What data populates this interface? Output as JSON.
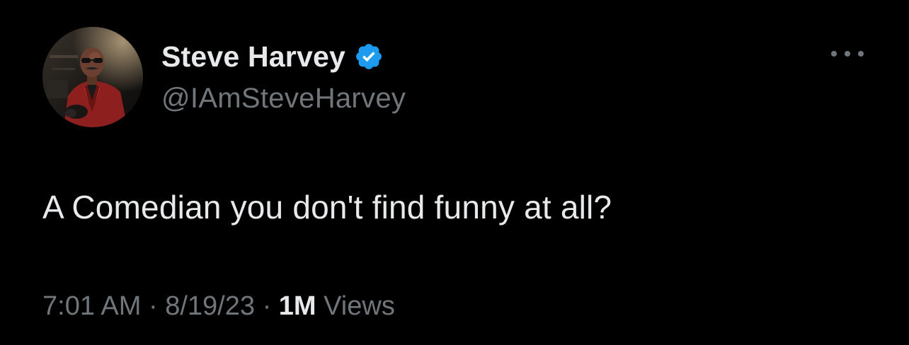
{
  "author": {
    "display_name": "Steve Harvey",
    "handle": "@IAmSteveHarvey",
    "verified": true,
    "verified_icon": "verified-badge-icon",
    "verified_color": "#1d9bf0"
  },
  "tweet": {
    "text": "A Comedian you don't find funny at all?",
    "time": "7:01 AM",
    "date": "8/19/23",
    "views_count": "1M",
    "views_label": "Views",
    "separator": "·"
  },
  "menu": {
    "icon": "more-options-icon"
  },
  "colors": {
    "background": "#000000",
    "primary_text": "#e7e9ea",
    "secondary_text": "#71767b"
  }
}
